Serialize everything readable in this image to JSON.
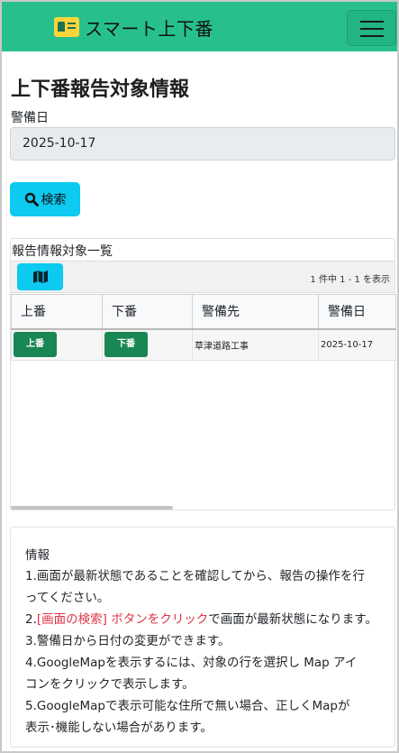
{
  "navbar": {
    "brand": "スマート上下番",
    "brand_icon": "id-card-icon",
    "toggler_icon": "hamburger-icon",
    "colors": {
      "bar": "#27c08c",
      "accent": "#ffd43b"
    }
  },
  "page": {
    "title": "上下番報告対象情報"
  },
  "filter": {
    "date_label": "警備日",
    "date_value": "2025-10-17",
    "search_label": "検索"
  },
  "list": {
    "title": "報告情報対象一覧",
    "map_icon": "map-icon",
    "paging": "1 件中 1 - 1 を表示",
    "columns": [
      "上番",
      "下番",
      "警備先",
      "警備日"
    ],
    "rows": [
      {
        "on_btn": "上番",
        "off_btn": "下番",
        "site": "草津道路工事",
        "date": "2025-10-17"
      }
    ]
  },
  "info": {
    "heading": "情報",
    "lines": [
      "1.画面が最新状態であることを確認してから、報告の操作を行",
      "ってください。",
      "で画面が最新状態になります。",
      "3.警備日から日付の変更ができます。",
      "4.GoogleMapを表示するには、対象の行を選択し Map アイ",
      "コンをクリックで表示します。",
      "5.GoogleMapで表示可能な住所で無い場合、正しくMapが",
      "表示･機能しない場合があります。"
    ],
    "line2_prefix": "2.",
    "line2_red": "[画面の検索] ボタンをクリック"
  }
}
